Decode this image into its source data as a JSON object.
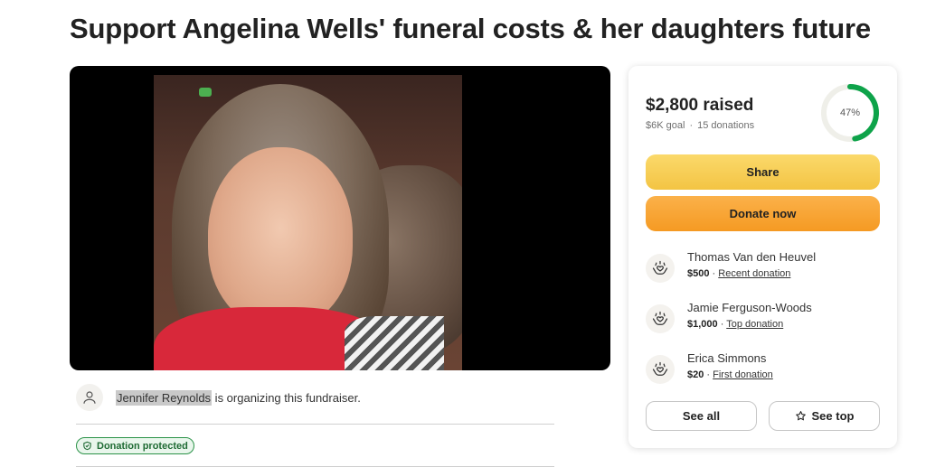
{
  "title": "Support Angelina Wells' funeral costs & her daughters future",
  "organizer": {
    "name": "Jennifer Reynolds",
    "text": " is organizing this fundraiser."
  },
  "badge": {
    "label": "Donation protected"
  },
  "stats": {
    "raised": "$2,800 raised",
    "goal": "$6K goal",
    "separator": "·",
    "donations": "15 donations",
    "progress_label": "47%",
    "progress_fraction": 0.47
  },
  "buttons": {
    "share": "Share",
    "donate": "Donate now",
    "see_all": "See all",
    "see_top": "See top"
  },
  "donors": [
    {
      "name": "Thomas Van den Heuvel",
      "amount": "$500",
      "sep": " · ",
      "tag": "Recent donation"
    },
    {
      "name": "Jamie Ferguson-Woods",
      "amount": "$1,000",
      "sep": " · ",
      "tag": "Top donation"
    },
    {
      "name": "Erica Simmons",
      "amount": "$20",
      "sep": " · ",
      "tag": "First donation"
    }
  ],
  "colors": {
    "progress": "#0ea34a",
    "share": "#f3c443",
    "donate": "#f59a23",
    "protected": "#2b9348"
  },
  "icons": {
    "avatar": "user-icon",
    "donor": "heart-hands-icon",
    "badge": "shield-icon",
    "see_top": "star-icon"
  }
}
